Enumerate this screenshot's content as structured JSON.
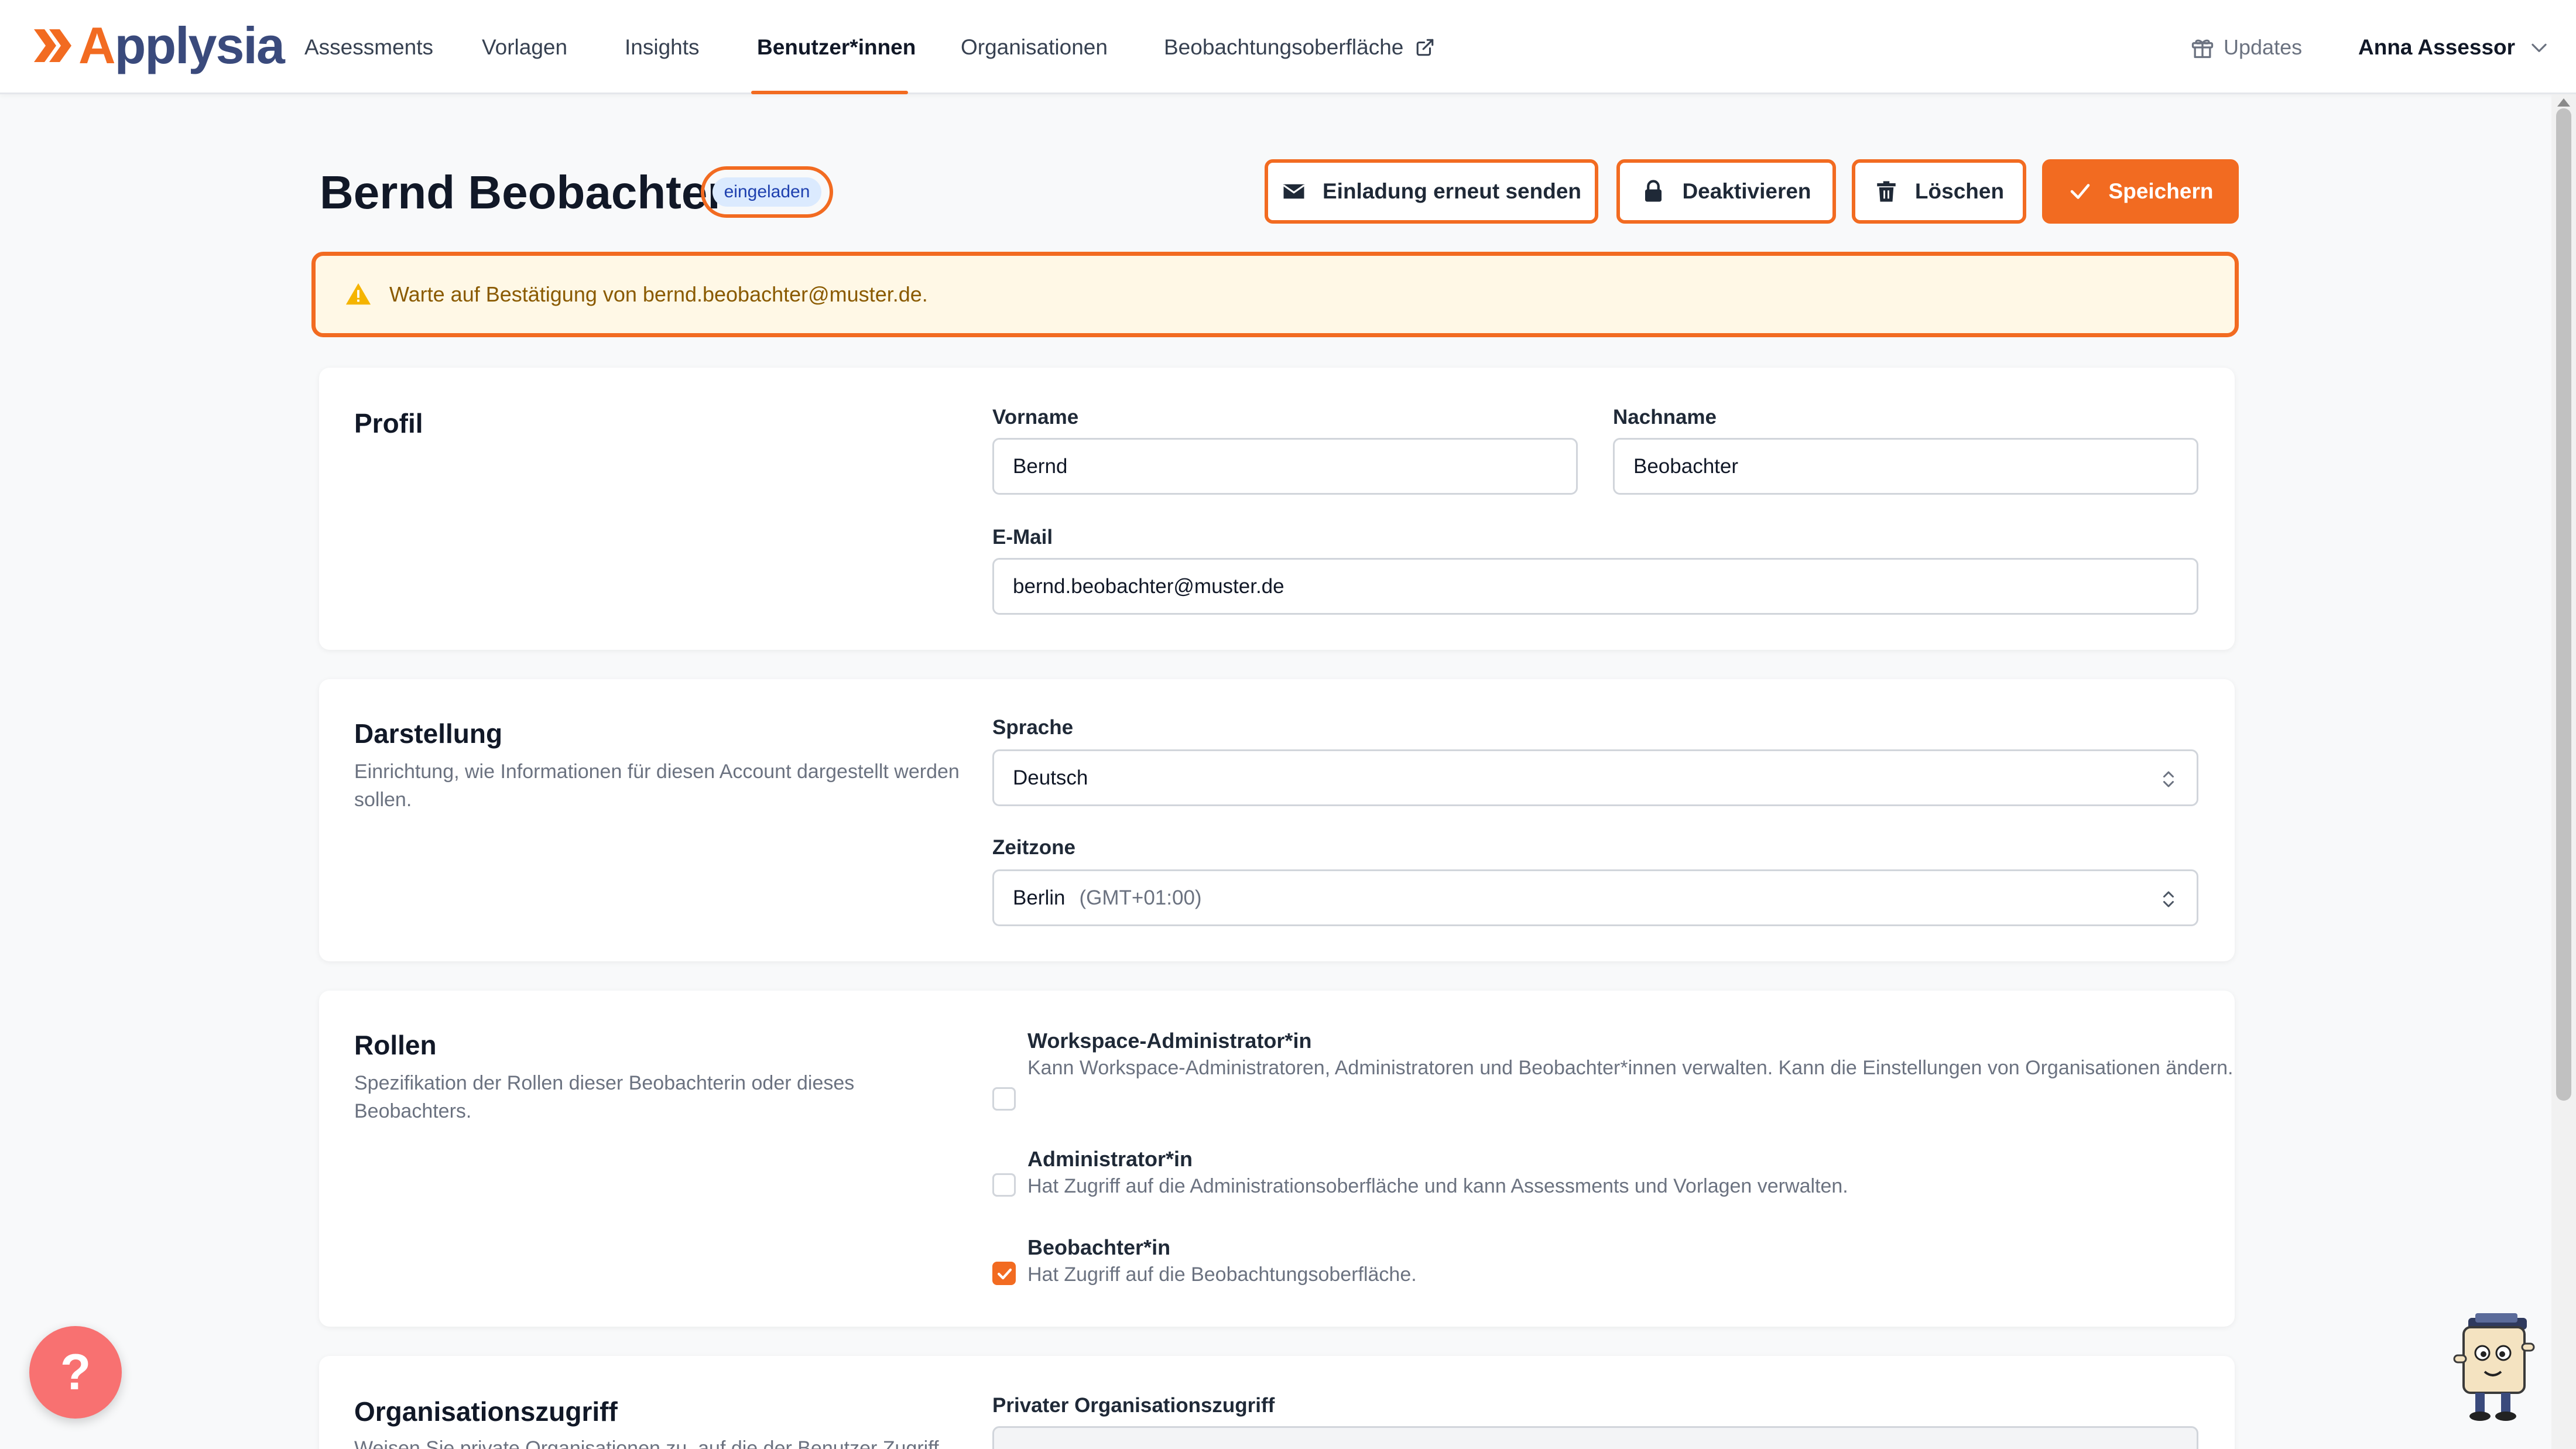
{
  "brand": {
    "logo_first": "A",
    "logo_rest": "pplysia"
  },
  "nav": {
    "items": [
      {
        "label": "Assessments"
      },
      {
        "label": "Vorlagen"
      },
      {
        "label": "Insights"
      },
      {
        "label": "Benutzer*innen"
      },
      {
        "label": "Organisationen"
      },
      {
        "label": "Beobachtungsoberfläche"
      }
    ],
    "active_index": 3,
    "updates_label": "Updates",
    "user_name": "Anna Assessor"
  },
  "header": {
    "title": "Bernd Beobachter",
    "status_badge": "eingeladen",
    "buttons": {
      "resend_label": "Einladung erneut senden",
      "deactivate_label": "Deaktivieren",
      "delete_label": "Löschen",
      "save_label": "Speichern"
    }
  },
  "alert": {
    "text": "Warte auf Bestätigung von bernd.beobachter@muster.de."
  },
  "profile": {
    "title": "Profil",
    "first_name_label": "Vorname",
    "first_name_value": "Bernd",
    "last_name_label": "Nachname",
    "last_name_value": "Beobachter",
    "email_label": "E-Mail",
    "email_value": "bernd.beobachter@muster.de"
  },
  "display": {
    "title": "Darstellung",
    "description": "Einrichtung, wie Informationen für diesen Account dargestellt werden sollen.",
    "language_label": "Sprache",
    "language_value": "Deutsch",
    "timezone_label": "Zeitzone",
    "timezone_city": "Berlin",
    "timezone_offset": "(GMT+01:00)"
  },
  "roles": {
    "title": "Rollen",
    "description": "Spezifikation der Rollen dieser Beobachterin oder dieses Beobachters.",
    "items": [
      {
        "title": "Workspace-Administrator*in",
        "description": "Kann Workspace-Administratoren, Administratoren und Beobachter*innen verwalten. Kann die Einstellungen von Organisationen ändern.",
        "checked": false
      },
      {
        "title": "Administrator*in",
        "description": "Hat Zugriff auf die Administrationsoberfläche und kann Assessments und Vorlagen verwalten.",
        "checked": false
      },
      {
        "title": "Beobachter*in",
        "description": "Hat Zugriff auf die Beobachtungsoberfläche.",
        "checked": true
      }
    ]
  },
  "org_access": {
    "title": "Organisationszugriff",
    "description": "Weisen Sie private Organisationen zu, auf die der Benutzer Zugriff",
    "private_label": "Privater Organisationszugriff"
  },
  "help": {
    "label": "?"
  },
  "colors": {
    "accent": "#f26b21",
    "navy": "#3a4a7c",
    "badge_bg": "#dbeafe",
    "alert_bg": "#fff8e6"
  }
}
